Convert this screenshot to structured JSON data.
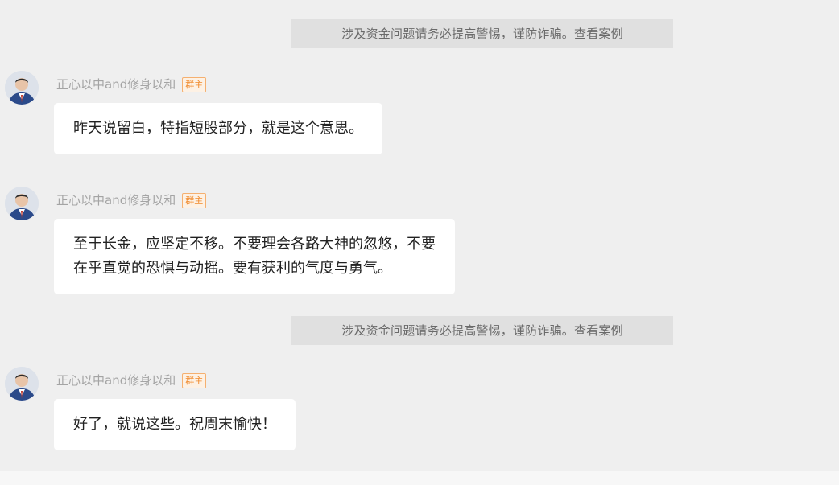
{
  "notices": [
    "涉及资金问题请务必提高警惕，谨防诈骗。查看案例",
    "涉及资金问题请务必提高警惕，谨防诈骗。查看案例"
  ],
  "messages": [
    {
      "sender": "正心以中and修身以和",
      "badge": "群主",
      "text": "昨天说留白，特指短股部分，就是这个意思。"
    },
    {
      "sender": "正心以中and修身以和",
      "badge": "群主",
      "text": "至于长金，应坚定不移。不要理会各路大神的忽悠，不要\n在乎直觉的恐惧与动摇。要有获利的气度与勇气。"
    },
    {
      "sender": "正心以中and修身以和",
      "badge": "群主",
      "text": "好了，就说这些。祝周末愉快！"
    }
  ],
  "colors": {
    "background": "#efefef",
    "notice_bg": "#e0e0e0",
    "bubble_bg": "#ffffff",
    "badge_accent": "#f08a2c"
  },
  "icons": {
    "avatar": "user-avatar-photo"
  }
}
